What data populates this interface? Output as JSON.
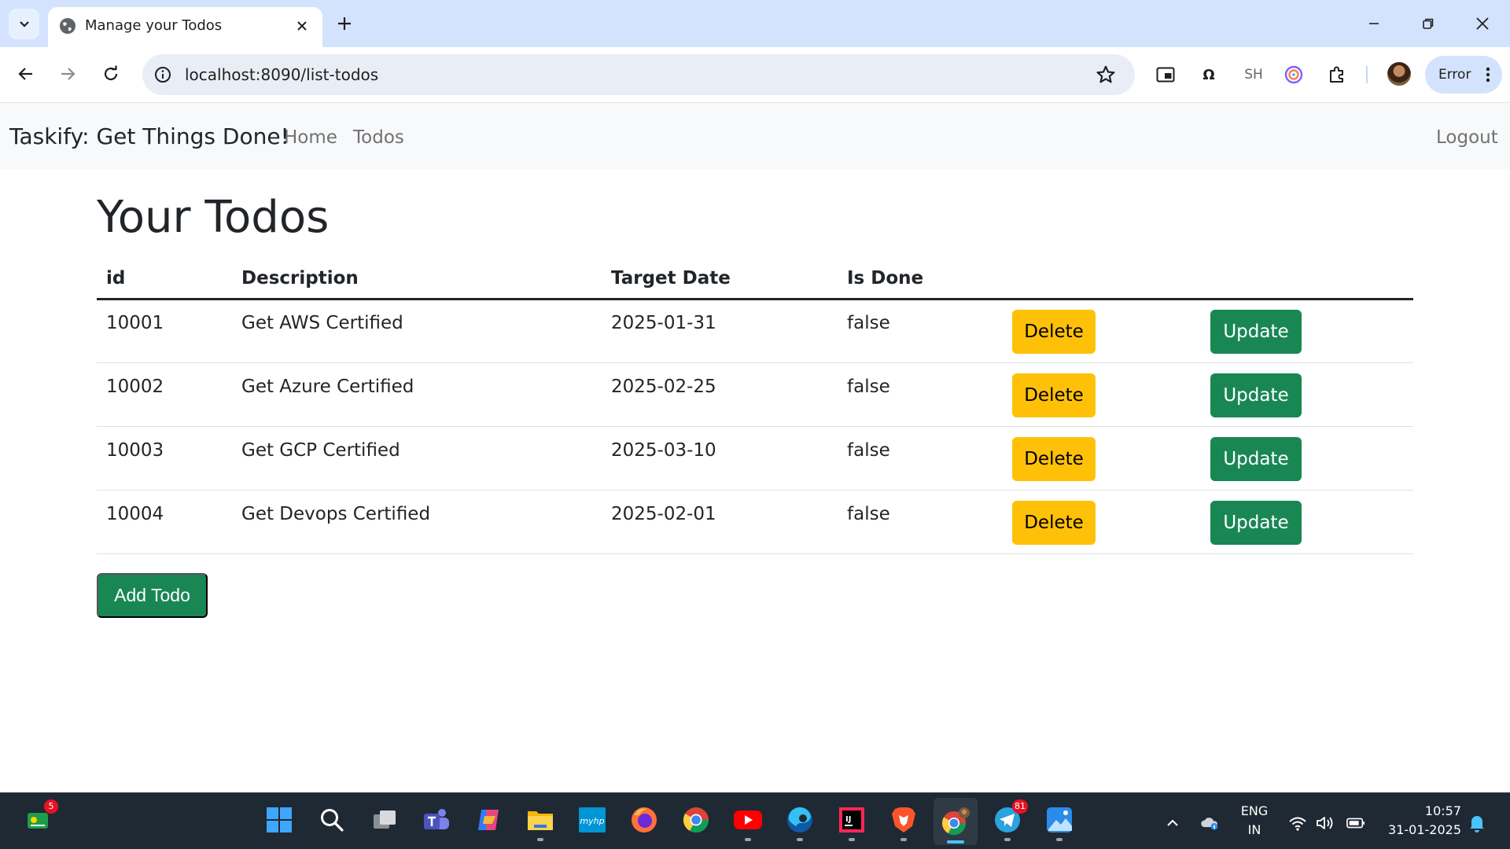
{
  "browser": {
    "tab_title": "Manage your Todos",
    "url": "localhost:8090/list-todos",
    "extension_sh": "SH",
    "extension_omega": "Ω",
    "profile_status": "Error"
  },
  "navbar": {
    "brand": "Taskify: Get Things Done!",
    "links": [
      "Home",
      "Todos"
    ],
    "logout": "Logout"
  },
  "page": {
    "title": "Your Todos",
    "columns": [
      "id",
      "Description",
      "Target Date",
      "Is Done"
    ],
    "todos": [
      {
        "id": "10001",
        "description": "Get AWS Certified",
        "target_date": "2025-01-31",
        "done": "false",
        "delete_label": "Delete",
        "update_label": "Update"
      },
      {
        "id": "10002",
        "description": "Get Azure Certified",
        "target_date": "2025-02-25",
        "done": "false",
        "delete_label": "Delete",
        "update_label": "Update"
      },
      {
        "id": "10003",
        "description": "Get GCP Certified",
        "target_date": "2025-03-10",
        "done": "false",
        "delete_label": "Delete",
        "update_label": "Update"
      },
      {
        "id": "10004",
        "description": "Get Devops Certified",
        "target_date": "2025-02-01",
        "done": "false",
        "delete_label": "Delete",
        "update_label": "Update"
      }
    ],
    "add_button": "Add Todo"
  },
  "taskbar": {
    "apps": [
      "widgets",
      "start",
      "search",
      "task-view",
      "teams",
      "copilot",
      "file-explorer",
      "myhp",
      "firefox",
      "chrome",
      "youtube",
      "edge",
      "intellij",
      "brave",
      "chrome-profile",
      "telegram",
      "photos"
    ],
    "widgets_badge": "5",
    "telegram_badge": "81",
    "language_top": "ENG",
    "language_bottom": "IN",
    "time": "10:57",
    "date": "31-01-2025"
  },
  "colors": {
    "warning": "#ffc107",
    "success": "#198754",
    "tabstrip": "#d3e3fd",
    "taskbar": "#1f2933"
  }
}
